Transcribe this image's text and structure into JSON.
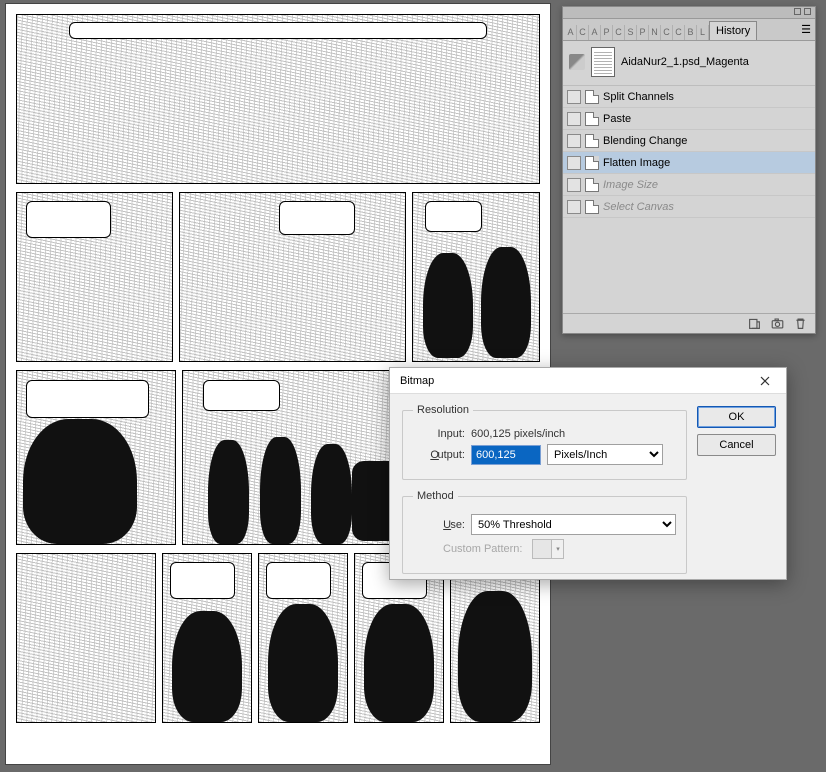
{
  "document": {
    "filename": "AidaNur2_1.psd_Magenta"
  },
  "history": {
    "tab_label": "History",
    "minitabs": [
      "A",
      "C",
      "A",
      "P",
      "C",
      "S",
      "P",
      "N",
      "C",
      "C",
      "B",
      "L"
    ],
    "items": [
      {
        "label": "Split Channels",
        "selected": false,
        "dim": false
      },
      {
        "label": "Paste",
        "selected": false,
        "dim": false
      },
      {
        "label": "Blending Change",
        "selected": false,
        "dim": false
      },
      {
        "label": "Flatten Image",
        "selected": true,
        "dim": false
      },
      {
        "label": "Image Size",
        "selected": false,
        "dim": true
      },
      {
        "label": "Select Canvas",
        "selected": false,
        "dim": true
      }
    ],
    "footer_icons": [
      "new-from-state-icon",
      "snapshot-icon",
      "trash-icon"
    ]
  },
  "dialog": {
    "title": "Bitmap",
    "ok_label": "OK",
    "cancel_label": "Cancel",
    "resolution": {
      "legend": "Resolution",
      "input_label": "Input:",
      "input_value": "600,125 pixels/inch",
      "output_label_prefix": "O",
      "output_label_rest": "utput:",
      "output_value": "600,125",
      "unit_options": [
        "Pixels/Inch"
      ],
      "unit_selected": "Pixels/Inch"
    },
    "method": {
      "legend": "Method",
      "use_label_prefix": "U",
      "use_label_rest": "se:",
      "use_options": [
        "50% Threshold"
      ],
      "use_selected": "50% Threshold",
      "custom_pattern_label": "Custom Pattern:"
    }
  }
}
